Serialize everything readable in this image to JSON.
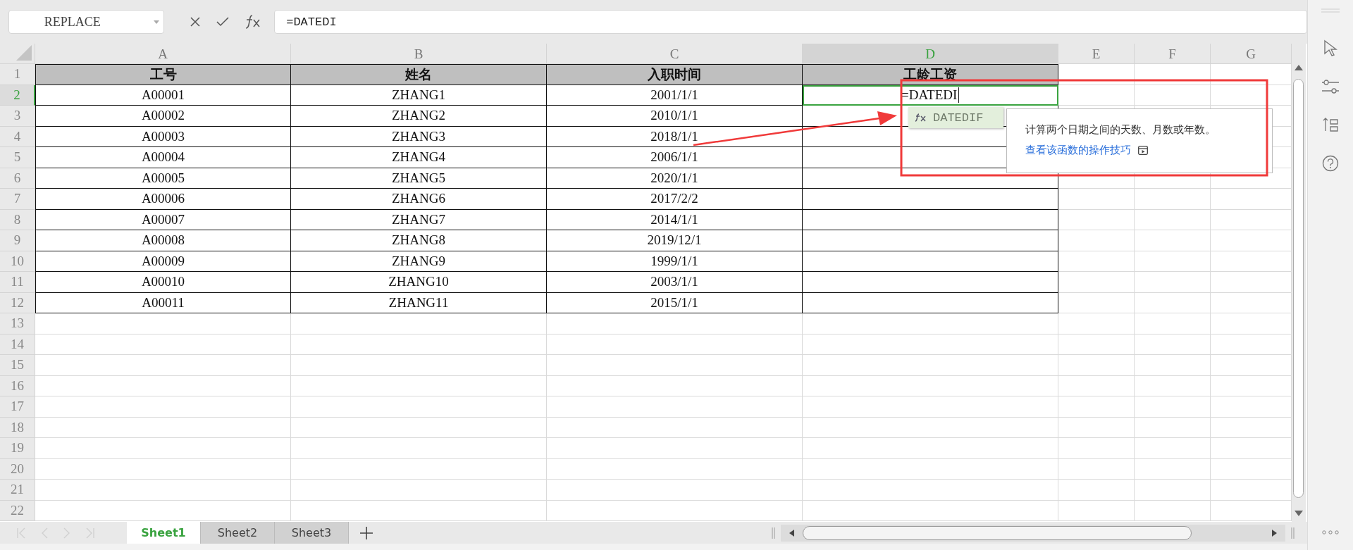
{
  "formula_bar": {
    "name_box": "REPLACE",
    "formula": "=DATEDI"
  },
  "columns": [
    {
      "label": "A",
      "selected": false
    },
    {
      "label": "B",
      "selected": false
    },
    {
      "label": "C",
      "selected": false
    },
    {
      "label": "D",
      "selected": true
    },
    {
      "label": "E",
      "selected": false
    },
    {
      "label": "F",
      "selected": false
    },
    {
      "label": "G",
      "selected": false
    }
  ],
  "row_numbers": [
    {
      "label": "1",
      "selected": false
    },
    {
      "label": "2",
      "selected": true
    },
    {
      "label": "3",
      "selected": false
    },
    {
      "label": "4",
      "selected": false
    },
    {
      "label": "5",
      "selected": false
    },
    {
      "label": "6",
      "selected": false
    },
    {
      "label": "7",
      "selected": false
    },
    {
      "label": "8",
      "selected": false
    },
    {
      "label": "9",
      "selected": false
    },
    {
      "label": "10",
      "selected": false
    },
    {
      "label": "11",
      "selected": false
    },
    {
      "label": "12",
      "selected": false
    },
    {
      "label": "13",
      "selected": false
    },
    {
      "label": "14",
      "selected": false
    },
    {
      "label": "15",
      "selected": false
    },
    {
      "label": "16",
      "selected": false
    },
    {
      "label": "17",
      "selected": false
    },
    {
      "label": "18",
      "selected": false
    },
    {
      "label": "19",
      "selected": false
    },
    {
      "label": "20",
      "selected": false
    },
    {
      "label": "21",
      "selected": false
    },
    {
      "label": "22",
      "selected": false
    }
  ],
  "table": {
    "header": [
      "工号",
      "姓名",
      "入职时间",
      "工龄工资"
    ],
    "rows": [
      [
        "A00001",
        "ZHANG1",
        "2001/1/1"
      ],
      [
        "A00002",
        "ZHANG2",
        "2010/1/1"
      ],
      [
        "A00003",
        "ZHANG3",
        "2018/1/1"
      ],
      [
        "A00004",
        "ZHANG4",
        "2006/1/1"
      ],
      [
        "A00005",
        "ZHANG5",
        "2020/1/1"
      ],
      [
        "A00006",
        "ZHANG6",
        "2017/2/2"
      ],
      [
        "A00007",
        "ZHANG7",
        "2014/1/1"
      ],
      [
        "A00008",
        "ZHANG8",
        "2019/12/1"
      ],
      [
        "A00009",
        "ZHANG9",
        "1999/1/1"
      ],
      [
        "A00010",
        "ZHANG10",
        "2003/1/1"
      ],
      [
        "A00011",
        "ZHANG11",
        "2015/1/1"
      ]
    ]
  },
  "cell_edit": "=DATEDI",
  "autocomplete": {
    "items": [
      {
        "label": "DATEDIF",
        "selected": true
      }
    ],
    "description": "计算两个日期之间的天数、月数或年数。",
    "link": "查看该函数的操作技巧"
  },
  "sheet_tabs": [
    {
      "label": "Sheet1",
      "selected": true
    },
    {
      "label": "Sheet2",
      "selected": false
    },
    {
      "label": "Sheet3",
      "selected": false
    }
  ]
}
